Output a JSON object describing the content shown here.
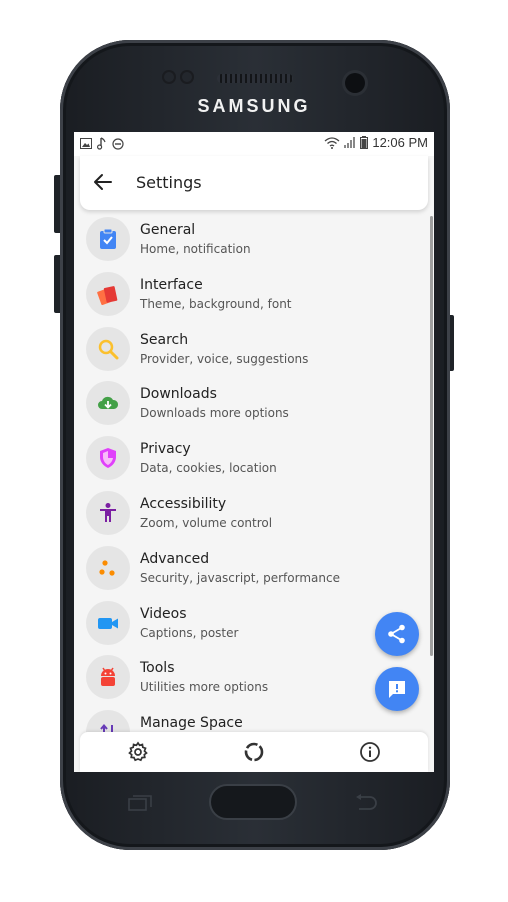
{
  "device": {
    "brand": "SAMSUNG"
  },
  "status_bar": {
    "time": "12:06 PM"
  },
  "app_bar": {
    "title": "Settings"
  },
  "settings_items": [
    {
      "title": "General",
      "subtitle": "Home, notification",
      "icon": "clipboard-check-icon",
      "color": "#4285f4"
    },
    {
      "title": "Interface",
      "subtitle": "Theme, background, font",
      "icon": "palette-card-icon",
      "color": "#f44336"
    },
    {
      "title": "Search",
      "subtitle": "Provider, voice, suggestions",
      "icon": "search-icon",
      "color": "#fbc02d"
    },
    {
      "title": "Downloads",
      "subtitle": "Downloads more options",
      "icon": "cloud-download-icon",
      "color": "#43a047"
    },
    {
      "title": "Privacy",
      "subtitle": "Data, cookies, location",
      "icon": "shield-icon",
      "color": "#e040fb"
    },
    {
      "title": "Accessibility",
      "subtitle": "Zoom, volume control",
      "icon": "accessibility-icon",
      "color": "#7b1fa2"
    },
    {
      "title": "Advanced",
      "subtitle": "Security, javascript, performance",
      "icon": "dots-cluster-icon",
      "color": "#fb8c00"
    },
    {
      "title": "Videos",
      "subtitle": "Captions, poster",
      "icon": "videocam-icon",
      "color": "#2196f3"
    },
    {
      "title": "Tools",
      "subtitle": "Utilities more options",
      "icon": "android-icon",
      "color": "#f44336"
    },
    {
      "title": "Manage Space",
      "subtitle": "",
      "icon": "swap-vert-icon",
      "color": "#673ab7"
    }
  ],
  "fabs": {
    "share_icon": "share-icon",
    "feedback_icon": "feedback-icon",
    "color": "#4285f4"
  },
  "bottom_nav": {
    "settings_icon": "gear-icon",
    "loading_icon": "loading-ring-icon",
    "info_icon": "info-icon"
  }
}
